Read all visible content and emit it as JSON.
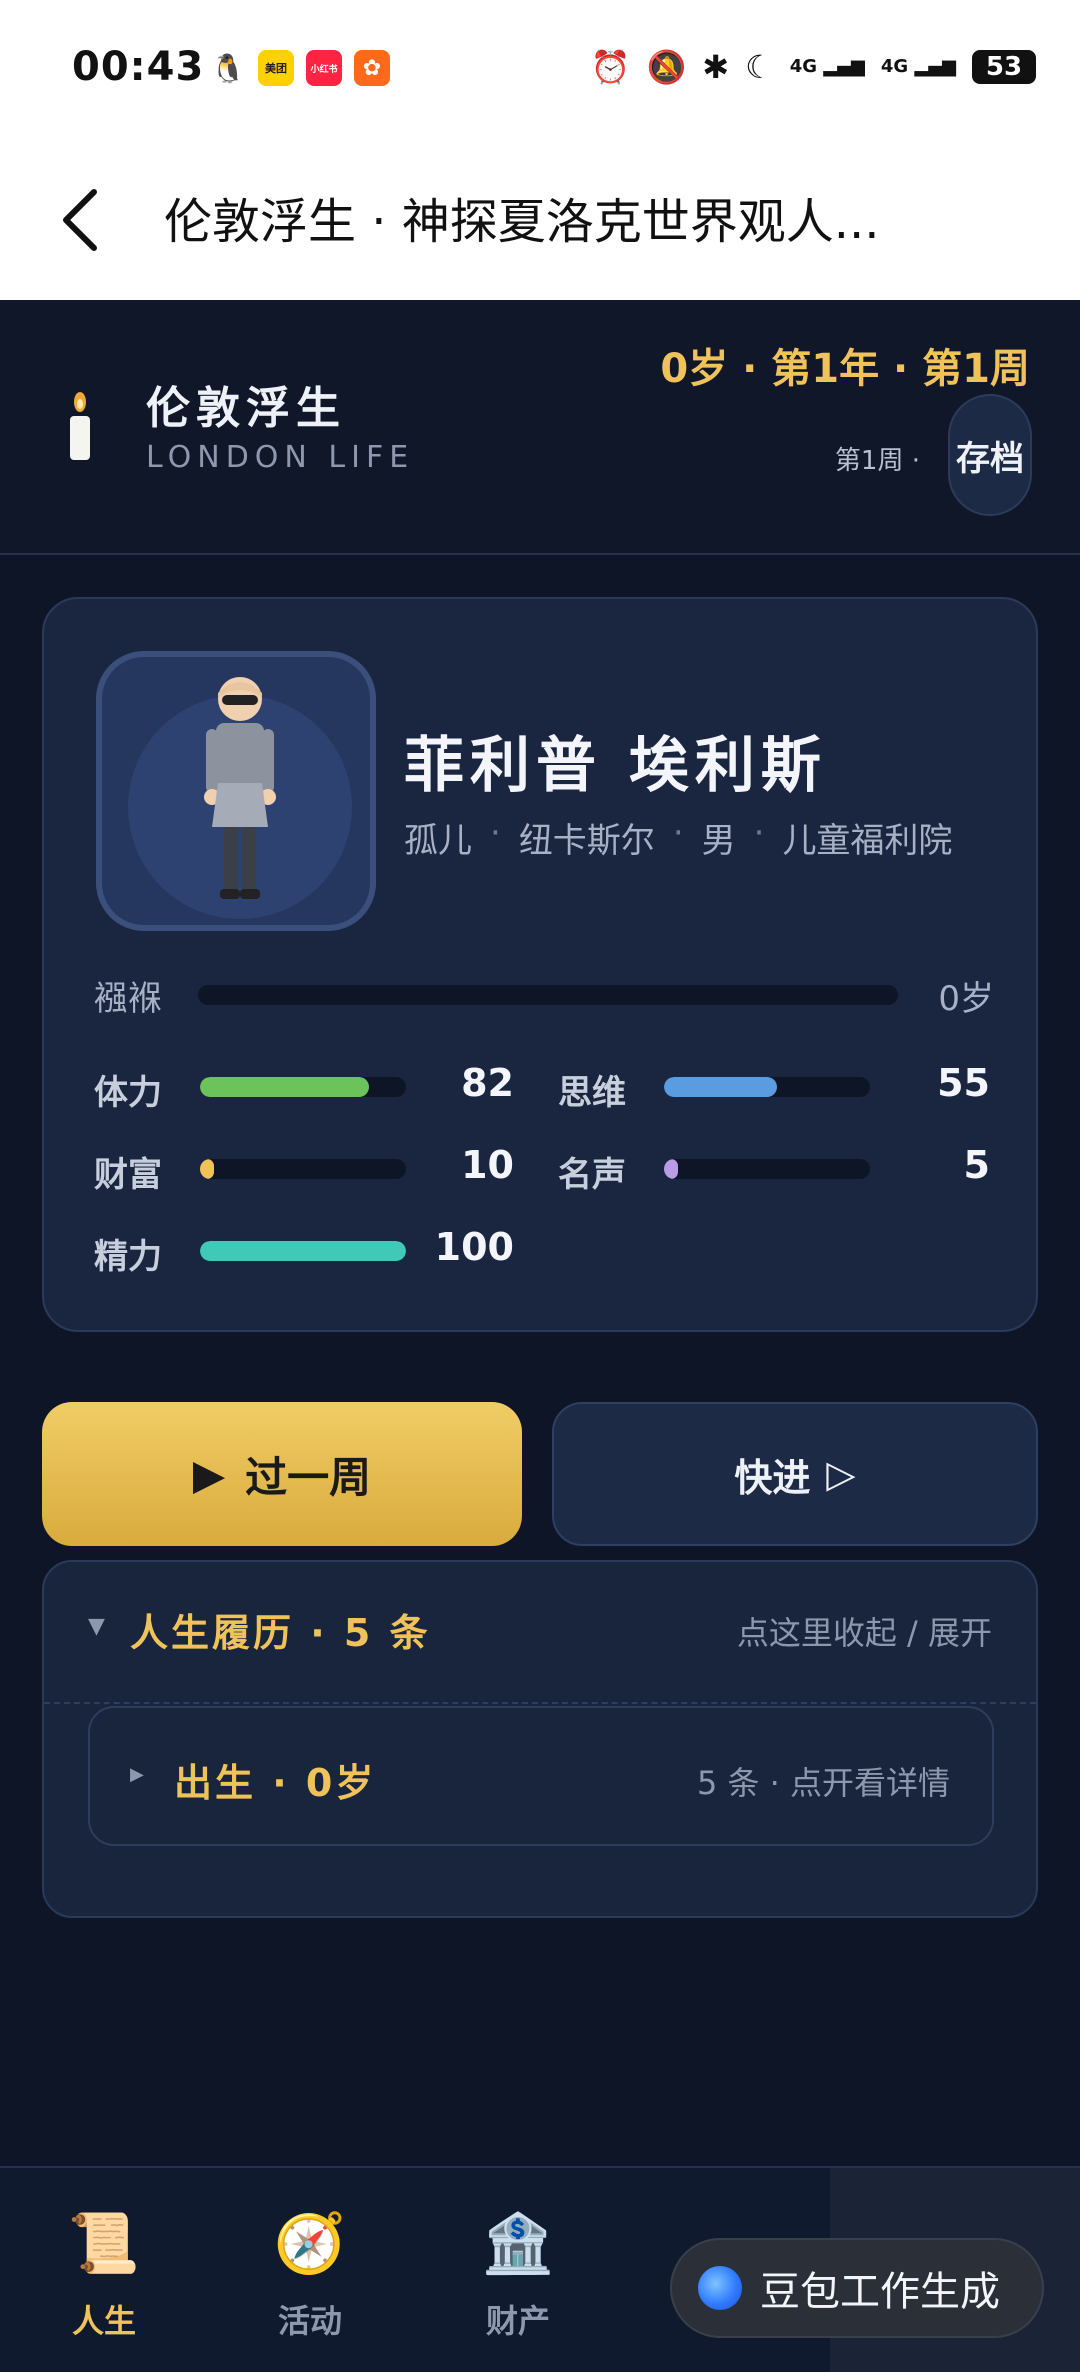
{
  "status_bar": {
    "time": "00:43",
    "apps": [
      "qq",
      "美团",
      "小红书",
      "taobao-special"
    ],
    "battery": "53",
    "signal_labels": [
      "4G",
      "4G"
    ]
  },
  "title_bar": {
    "title": "伦敦浮生 · 神探夏洛克世界观人..."
  },
  "game_header": {
    "brand_cn": "伦敦浮生",
    "brand_en": "LONDON LIFE",
    "age_week": "0岁 · 第1年 · 第1周",
    "week_small": "第1周 ·",
    "save_label": "存档"
  },
  "profile": {
    "name": "菲利普 埃利斯",
    "tags": [
      "孤儿",
      "纽卡斯尔",
      "男",
      "儿童福利院"
    ],
    "tag_sep": "·",
    "life_stage": "襁褓",
    "age_value": "0岁",
    "age_progress": 0,
    "stats": [
      {
        "label": "体力",
        "value": "82",
        "progress": 0.82,
        "color": "#6cc35a"
      },
      {
        "label": "思维",
        "value": "55",
        "progress": 0.55,
        "color": "#5b9be0"
      },
      {
        "label": "财富",
        "value": "10",
        "progress": 0.07,
        "color": "#f0c35a"
      },
      {
        "label": "名声",
        "value": "5",
        "progress": 0.03,
        "color": "#b99be6"
      },
      {
        "label": "精力",
        "value": "100",
        "progress": 1.0,
        "color": "#3fc9b6"
      }
    ]
  },
  "actions": {
    "next_label": "过一周",
    "next_glyph": "▶",
    "fast_label": "快进",
    "fast_glyph": "▷"
  },
  "history": {
    "caret": "▼",
    "title": "人生履历 · 5 条",
    "hint": "点这里收起 / 展开",
    "entries": [
      {
        "caret": "▶",
        "title": "出生 · 0岁",
        "hint": "5 条 · 点开看详情"
      }
    ]
  },
  "bottom_nav": {
    "items": [
      {
        "label": "人生",
        "icon": "scroll-icon",
        "glyph": "📜",
        "active": true
      },
      {
        "label": "活动",
        "icon": "compass-icon",
        "glyph": "🧭",
        "active": false
      },
      {
        "label": "财产",
        "icon": "bank-icon",
        "glyph": "🏦",
        "active": false
      }
    ]
  },
  "doubao": {
    "label": "豆包工作生成"
  }
}
